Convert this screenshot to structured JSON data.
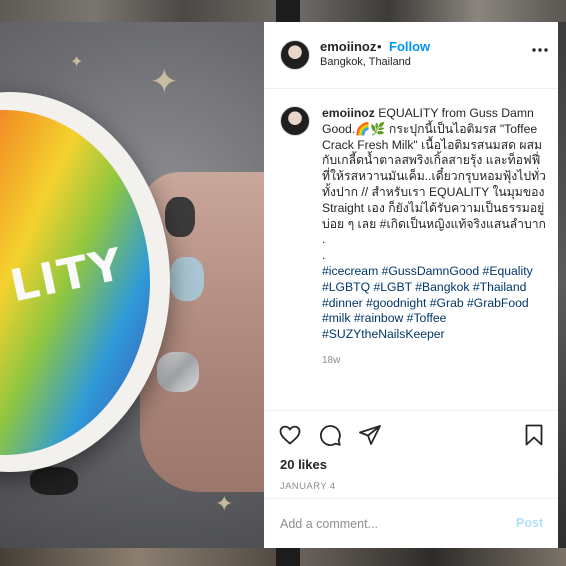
{
  "post": {
    "username": "emoiinoz",
    "separator": "•",
    "follow_label": "Follow",
    "location": "Bangkok, Thailand",
    "more_label": "•••"
  },
  "caption": {
    "username": "emoiinoz",
    "text": " EQUALITY from Guss Damn Good.🌈🌿 กระปุกนี้เป็นไอติมรส \"Toffee Crack Fresh Milk\" เนื้อไอติมรสนมสด ผสมกับเกลี้ดน้ำตาลสพริงเกิ้ลสายรุ้ง และท็อฟฟี่ที่ให้รสหวานมันเค็ม..เดี๋ยวกรุบหอมฟุ้งไปทั่วทั้งปาก // สำหรับเรา EQUALITY ในมุมของ Straight เอง ก็ยังไม่ได้รับความเป็นธรรมอยู่บ่อย ๆ เลย #เกิดเป็นหญิงแท้จริงแสนลำบาก",
    "dot1": ".",
    "dot2": ".",
    "hashtags": "#icecream #GussDamnGood #Equality #LGBTQ #LGBT #Bangkok #Thailand #dinner #goodnight #Grab #GrabFood #milk #rainbow #Toffee #SUZYtheNailsKeeper",
    "time": "18w"
  },
  "photo": {
    "cup_text": "LITY"
  },
  "actions": {
    "likes": "20 likes",
    "date": "JANUARY 4",
    "like_icon": "heart-icon",
    "comment_icon": "comment-icon",
    "share_icon": "paper-plane-icon",
    "save_icon": "bookmark-icon"
  },
  "comment_box": {
    "placeholder": "Add a comment...",
    "post_label": "Post"
  },
  "colors": {
    "link_blue": "#0095f6",
    "hashtag_blue": "#00376b",
    "post_disabled": "#b2dffc",
    "muted": "#8e8e8e"
  }
}
